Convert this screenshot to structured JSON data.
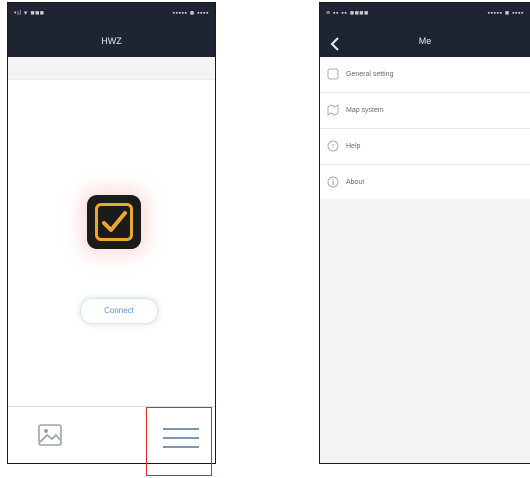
{
  "left_screen": {
    "status_left": "•ıl ▾ ■■■",
    "status_right": "▪▪▪▪▪ ■ ▪▪▪▪",
    "title": "HWZ",
    "connect_label": "Connect",
    "tabs": [
      {
        "icon": "gallery-icon"
      },
      {
        "icon": "menu-icon"
      }
    ]
  },
  "right_screen": {
    "status_left": "≡ ▪▪ ▪▪ ■■■■",
    "status_right": "▪▪▪▪▪ ■ ▪▪▪▪",
    "title": "Me",
    "items": [
      {
        "label": "General setting",
        "icon": "settings-icon"
      },
      {
        "label": "Map system",
        "icon": "map-system-icon"
      },
      {
        "label": "Help",
        "icon": "help-icon"
      },
      {
        "label": "About",
        "icon": "about-icon"
      }
    ]
  },
  "colors": {
    "header": "#1f2433",
    "accent_check": "#e9a82e",
    "connect_text": "#5b8fd0",
    "highlight": "#e1262a"
  }
}
